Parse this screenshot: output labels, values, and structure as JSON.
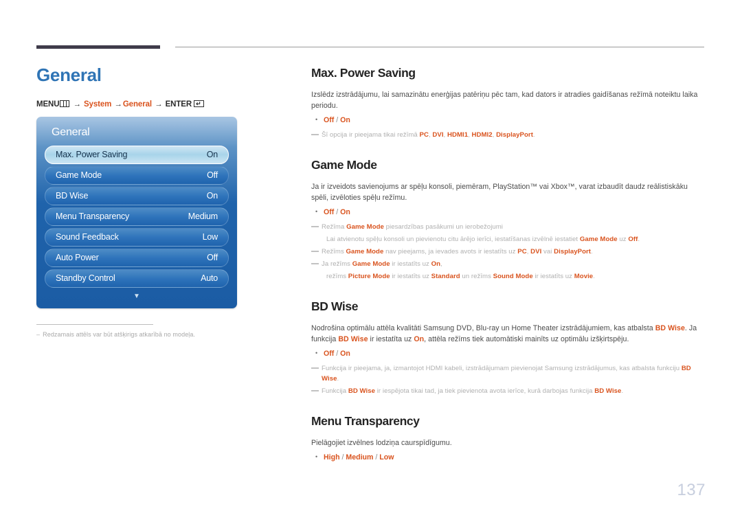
{
  "page": {
    "number": "137",
    "title": "General"
  },
  "breadcrumb": {
    "menu_label": "MENU",
    "menu_icon": "menu-grid-icon",
    "arrow": "→",
    "step1": "System",
    "step2": "General",
    "enter_label": "ENTER",
    "enter_icon": "enter-key-icon",
    "enter_glyph": "↵"
  },
  "osd": {
    "title": "General",
    "caret_icon": "chevron-down-icon",
    "rows": [
      {
        "label": "Max. Power Saving",
        "value": "On",
        "selected": true
      },
      {
        "label": "Game Mode",
        "value": "Off",
        "selected": false
      },
      {
        "label": "BD Wise",
        "value": "On",
        "selected": false
      },
      {
        "label": "Menu Transparency",
        "value": "Medium",
        "selected": false
      },
      {
        "label": "Sound Feedback",
        "value": "Low",
        "selected": false
      },
      {
        "label": "Auto Power",
        "value": "Off",
        "selected": false
      },
      {
        "label": "Standby Control",
        "value": "Auto",
        "selected": false
      }
    ]
  },
  "left_footnote": {
    "dash": "–",
    "text": "Redzamais attēls var būt atšķirigs atkarībā no modeļa."
  },
  "sections": {
    "max_power_saving": {
      "title": "Max. Power Saving",
      "desc": "Izslēdz izstrādājumu, lai samazinātu enerģijas patēriņu pēc tam, kad dators ir atradies gaidīšanas režīmā noteiktu laika periodu.",
      "options_a": "Off",
      "options_sep": "/",
      "options_b": "On",
      "note1_pre": "Šī opcija ir pieejama tikai režīmā ",
      "note1_hl1": "PC",
      "note1_mid1": ", ",
      "note1_hl2": "DVI",
      "note1_mid2": ", ",
      "note1_hl3": "HDMI1",
      "note1_mid3": ", ",
      "note1_hl4": "HDMI2",
      "note1_mid4": ", ",
      "note1_hl5": "DisplayPort",
      "note1_end": "."
    },
    "game_mode": {
      "title": "Game Mode",
      "desc": "Ja ir izveidots savienojums ar spēļu konsoli, piemēram, PlayStation™ vai Xbox™, varat izbaudīt daudz reālistiskāku spēli, izvēloties spēļu režīmu.",
      "options_a": "Off",
      "options_sep": "/",
      "options_b": "On",
      "note1_pre": "Režīma ",
      "note1_hl": "Game Mode",
      "note1_post": " piesardzības pasākumi un ierobežojumi",
      "note1_sub_pre": "Lai atvienotu spēļu konsoli un pievienotu citu ārējo ierīci, iestatīšanas izvēlnē iestatiet ",
      "note1_sub_hl1": "Game Mode",
      "note1_sub_mid": " uz ",
      "note1_sub_hl2": "Off",
      "note1_sub_end": ".",
      "note2_pre": "Režīms ",
      "note2_hl1": "Game Mode",
      "note2_mid1": " nav pieejams, ja ievades avots ir iestatīts uz ",
      "note2_hl2": "PC",
      "note2_mid2": ", ",
      "note2_hl3": "DVI",
      "note2_mid3": " vai ",
      "note2_hl4": "DisplayPort",
      "note2_end": ".",
      "note3_pre": "Ja režīms ",
      "note3_hl1": "Game Mode",
      "note3_mid1": " ir iestatīts uz ",
      "note3_hl2": "On",
      "note3_end": ",",
      "note3_sub_pre": "režīms ",
      "note3_sub_hl1": "Picture Mode",
      "note3_sub_mid1": " ir iestatīts uz ",
      "note3_sub_hl2": "Standard",
      "note3_sub_mid2": " un režīms ",
      "note3_sub_hl3": "Sound Mode",
      "note3_sub_mid3": " ir iestatīts uz ",
      "note3_sub_hl4": "Movie",
      "note3_sub_end": "."
    },
    "bd_wise": {
      "title": "BD Wise",
      "desc_pre": "Nodrošina optimālu attēla kvalitāti Samsung DVD, Blu-ray un Home Theater izstrādājumiem, kas atbalsta ",
      "desc_hl1": "BD Wise",
      "desc_mid1": ". Ja funkcija ",
      "desc_hl2": "BD Wise",
      "desc_mid2": " ir iestatīta uz ",
      "desc_hl3": "On",
      "desc_end": ", attēla režīms tiek automātiski mainīts uz optimālu izšķirtspēju.",
      "options_a": "Off",
      "options_sep": "/",
      "options_b": "On",
      "note1_pre": "Funkcija ir pieejama, ja, izmantojot HDMI kabeli, izstrādājumam pievienojat Samsung izstrādājumus, kas atbalsta funkciju ",
      "note1_hl": "BD Wise",
      "note1_end": ".",
      "note2_pre": "Funkcija ",
      "note2_hl1": "BD Wise",
      "note2_mid": " ir iespējota tikai tad, ja tiek pievienota avota ierīce, kurā darbojas funkcija ",
      "note2_hl2": "BD Wise",
      "note2_end": "."
    },
    "menu_transparency": {
      "title": "Menu Transparency",
      "desc": "Pielāgojiet izvēlnes lodziņa caurspīdīgumu.",
      "options_a": "High",
      "options_sep1": "/",
      "options_b": "Medium",
      "options_sep2": "/",
      "options_c": "Low"
    }
  },
  "colors": {
    "accent_orange": "#d9531e",
    "title_blue": "#2f74b5",
    "osd_blue": "#1f63ab",
    "page_number": "#c7cede"
  }
}
